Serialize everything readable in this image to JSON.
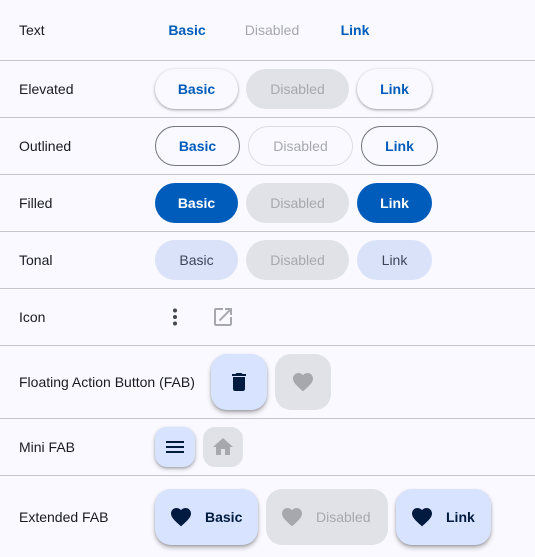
{
  "rows": {
    "text": {
      "label": "Text",
      "basic": "Basic",
      "disabled": "Disabled",
      "link": "Link"
    },
    "elevated": {
      "label": "Elevated",
      "basic": "Basic",
      "disabled": "Disabled",
      "link": "Link"
    },
    "outlined": {
      "label": "Outlined",
      "basic": "Basic",
      "disabled": "Disabled",
      "link": "Link"
    },
    "filled": {
      "label": "Filled",
      "basic": "Basic",
      "disabled": "Disabled",
      "link": "Link"
    },
    "tonal": {
      "label": "Tonal",
      "basic": "Basic",
      "disabled": "Disabled",
      "link": "Link"
    },
    "icon": {
      "label": "Icon",
      "icons": [
        "more-vert-icon",
        "open-in-new-icon"
      ]
    },
    "fab": {
      "label": "Floating Action Button (FAB)",
      "icons": [
        "delete-icon",
        "favorite-icon"
      ]
    },
    "mini_fab": {
      "label": "Mini FAB",
      "icons": [
        "menu-icon",
        "home-icon"
      ]
    },
    "extended_fab": {
      "label": "Extended FAB",
      "basic": "Basic",
      "disabled": "Disabled",
      "link": "Link",
      "icon": "favorite-icon"
    }
  },
  "colors": {
    "primary": "#005cbb",
    "disabled_bg": "#e1e2e8",
    "disabled_text": "#a7a8ae",
    "tonal_bg": "#dae2f9",
    "fab_bg": "#d7e3ff",
    "background": "#f9f9ff"
  }
}
